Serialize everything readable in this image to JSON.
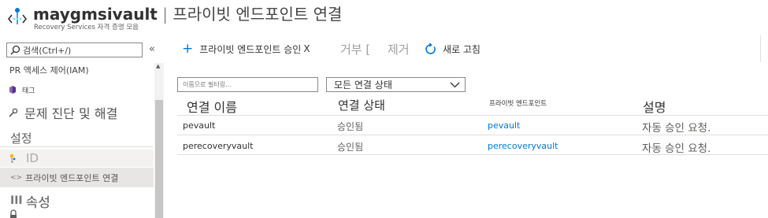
{
  "header": {
    "vault_name": "maygmsivault",
    "separator": " | ",
    "page_title": "프라이빗 엔드포인트 연결",
    "subtitle": "Recovery Services 자격 증명 모음"
  },
  "sidebar": {
    "search_placeholder": "검색(Ctrl+/)",
    "collapse_glyph": "«",
    "items": [
      {
        "label": "PR 액세스 제어(IAM)"
      },
      {
        "label": "태그",
        "icon": "tag-icon"
      },
      {
        "label": "문제 진단 및 해결",
        "icon": "wrench-icon"
      },
      {
        "label": "설정"
      },
      {
        "label": "ID",
        "icon": "identity-key-icon"
      },
      {
        "label": "프라이빗 엔드포인트 연결",
        "icon": "code-brackets-icon",
        "icon_glyph": "<>"
      },
      {
        "label": "속성",
        "icon": "properties-icon",
        "icon_glyph": "III"
      },
      {
        "label": "",
        "icon": "lock-icon"
      }
    ]
  },
  "toolbar": {
    "approve_label": "프라이빗 엔드포인트 승인",
    "approve_suffix": "X",
    "reject_label": "거부 [",
    "remove_label": "제거",
    "refresh_label": "새로 고침"
  },
  "filters": {
    "name_placeholder": "이름으로 필터링...",
    "state_selected": "모든 연결 상태"
  },
  "table": {
    "columns": [
      "연결 이름",
      "연결 상태",
      "프라이빗 엔드포인트",
      "설명"
    ],
    "rows": [
      {
        "name": "pevault",
        "state": "승인됨",
        "endpoint": "pevault",
        "description": "자동 승인 요청."
      },
      {
        "name": "perecoveryvault",
        "state": "승인됨",
        "endpoint": "perecoveryvault",
        "description": "자동 승인 요청."
      }
    ]
  },
  "colors": {
    "accent": "#0078d4",
    "text": "#323130",
    "disabled": "#a19f9d",
    "selected_bg": "#e8e6e4"
  }
}
